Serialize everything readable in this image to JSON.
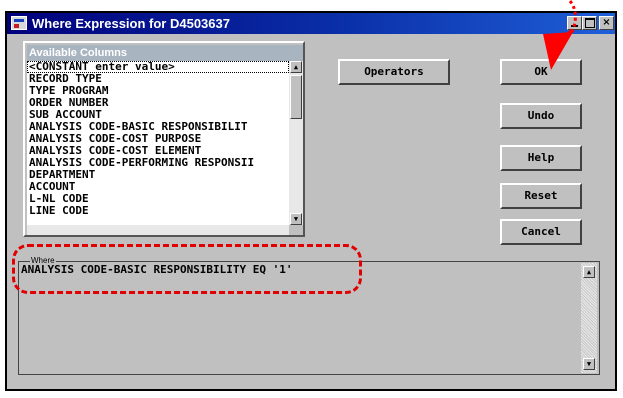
{
  "window": {
    "title": "Where Expression for D4503637",
    "controls": {
      "close": "×"
    }
  },
  "available_columns": {
    "header": "Available Columns",
    "items": [
      "<CONSTANT enter value>",
      "RECORD TYPE",
      "TYPE PROGRAM",
      "ORDER NUMBER",
      "SUB ACCOUNT",
      "ANALYSIS CODE-BASIC RESPONSIBILIT",
      "ANALYSIS CODE-COST PURPOSE",
      "ANALYSIS CODE-COST ELEMENT",
      "ANALYSIS CODE-PERFORMING RESPONSII",
      "DEPARTMENT",
      "ACCOUNT",
      "L-NL CODE",
      "LINE CODE"
    ],
    "selected_index": 0
  },
  "buttons": {
    "operators": "Operators",
    "ok": "OK",
    "undo": "Undo",
    "help": "Help",
    "reset": "Reset",
    "cancel": "Cancel"
  },
  "where": {
    "label": "Where",
    "expression": "ANALYSIS CODE-BASIC RESPONSIBILITY EQ '1'"
  },
  "annotation_colors": {
    "highlight": "#e00000",
    "arrow": "#ff0000"
  }
}
